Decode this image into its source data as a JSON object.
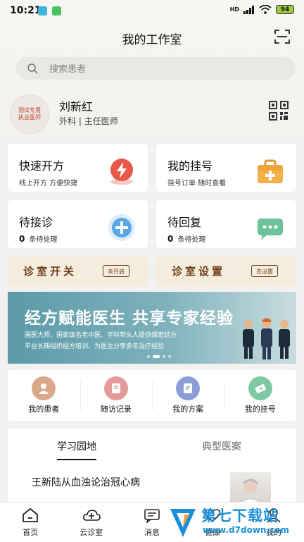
{
  "status_bar": {
    "time": "10:21",
    "signal": "HD",
    "battery": "94"
  },
  "header": {
    "title": "我的工作室"
  },
  "search": {
    "placeholder": "搜索患者"
  },
  "profile": {
    "avatar_line1": "测试专用",
    "avatar_line2": "执业医师",
    "name": "刘新红",
    "dept": "外科 | 主任医师"
  },
  "cards": {
    "quick_rx": {
      "title": "快速开方",
      "sub": "线上开方 方便快捷"
    },
    "my_reg": {
      "title": "我的挂号",
      "sub": "挂号订单 随时查看"
    },
    "wait_visit": {
      "title": "待接诊",
      "count": "0",
      "sub": "条待处理"
    },
    "wait_reply": {
      "title": "待回复",
      "count": "0",
      "sub": "条待处理"
    }
  },
  "switches": {
    "clinic_switch": {
      "title": "诊室开关",
      "button": "未开启"
    },
    "clinic_settings": {
      "title": "诊室设置",
      "button": "去设置"
    }
  },
  "banner": {
    "title": "经方赋能医生 共享专家经验",
    "line1": "国医大师、国家级名老中医、学科带头人提供保密经方",
    "line2": "平台长期组织经方培训，为医生分享多年治疗经验"
  },
  "quick_nav": [
    {
      "label": "我的患者",
      "color": "#d9a78a"
    },
    {
      "label": "随访记录",
      "color": "#e59a9a"
    },
    {
      "label": "我的方案",
      "color": "#8b9fd6"
    },
    {
      "label": "我的挂号",
      "color": "#7cc9a3"
    }
  ],
  "study": {
    "tab_active": "学习园地",
    "tab_other": "典型医案",
    "article_title": "王新陆从血浊论治冠心病"
  },
  "bottom_nav": [
    {
      "label": "首页",
      "icon": "home-icon"
    },
    {
      "label": "云诊室",
      "icon": "cloud-clinic-icon"
    },
    {
      "label": "消息",
      "icon": "message-icon"
    },
    {
      "label": "健康",
      "icon": "health-icon"
    },
    {
      "label": "我的",
      "icon": "profile-icon"
    }
  ],
  "watermark": {
    "text1": "第七下载站",
    "text2": "www.d7down.com"
  },
  "colors": {
    "accent_red": "#e8584a",
    "accent_orange": "#f0a23c",
    "accent_blue": "#5aa7e6",
    "accent_green": "#6cc29a",
    "brown": "#6b3d19"
  }
}
